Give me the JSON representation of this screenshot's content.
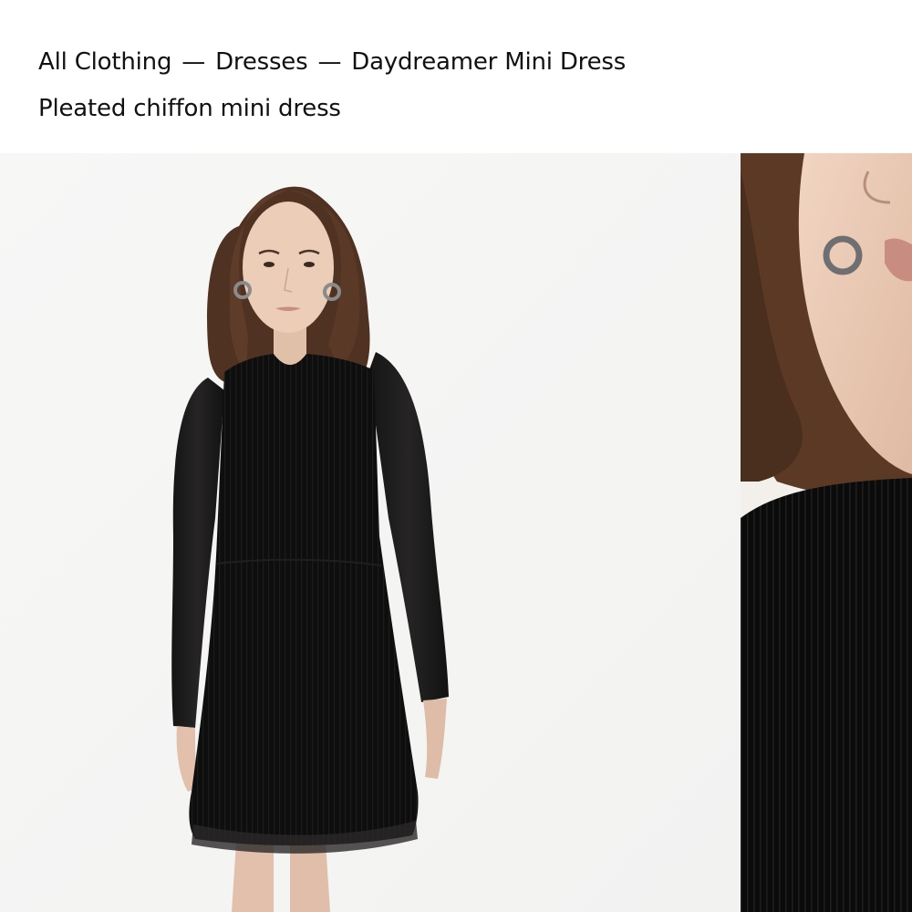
{
  "breadcrumb": {
    "items": [
      {
        "label": "All Clothing"
      },
      {
        "label": "Dresses"
      },
      {
        "label": "Daydreamer Mini Dress"
      }
    ],
    "separator": "—"
  },
  "product": {
    "subtitle": "Pleated chiffon mini dress"
  },
  "gallery": {
    "images": [
      {
        "subject": "model-full-length-front"
      },
      {
        "subject": "model-neckline-close-up"
      }
    ]
  },
  "colors": {
    "text": "#111111",
    "background": "#ffffff",
    "photo_backdrop": "#f6f6f5",
    "dress": "#0d0d0d",
    "hair": "#5a3a28",
    "skin": "#e8c9b4"
  }
}
